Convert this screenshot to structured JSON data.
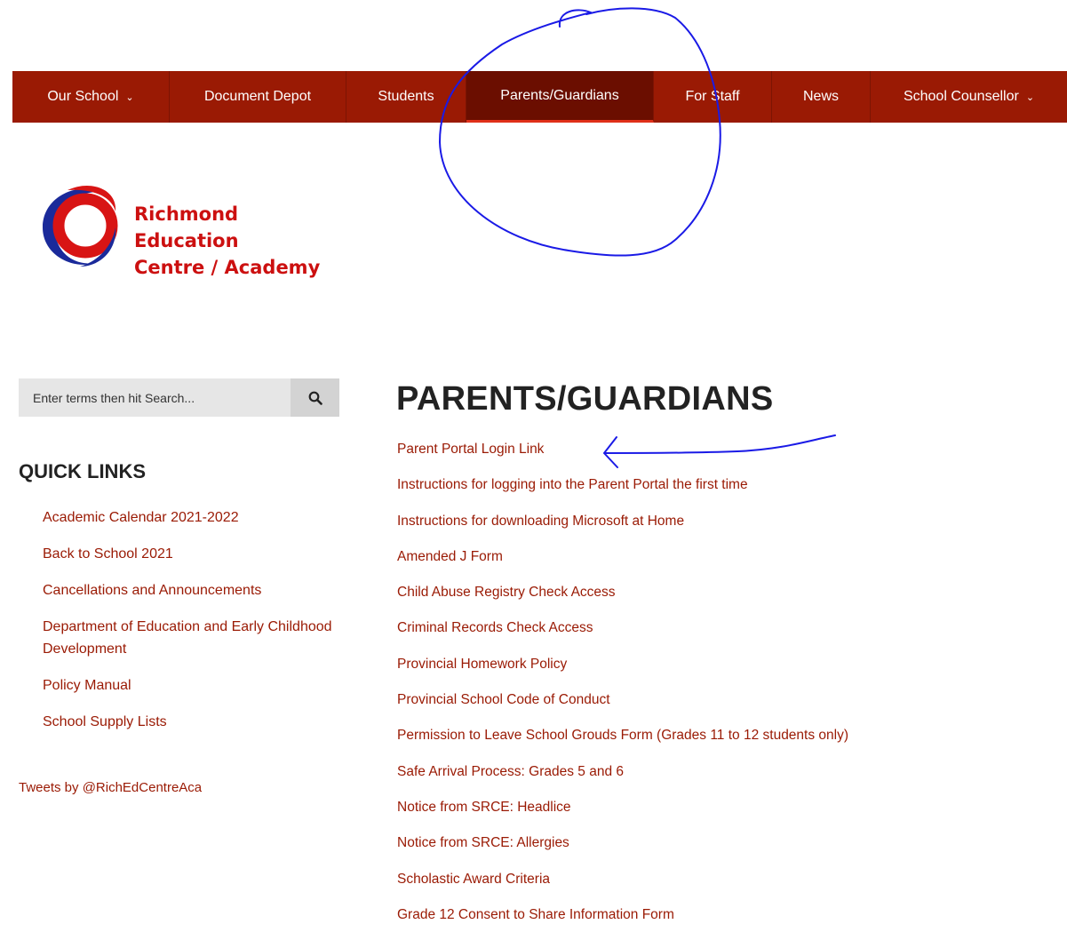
{
  "nav": {
    "items": [
      {
        "label": "Our School",
        "dropdown": true
      },
      {
        "label": "Document Depot",
        "dropdown": false
      },
      {
        "label": "Students",
        "dropdown": false
      },
      {
        "label": "Parents/Guardians",
        "dropdown": false,
        "active": true
      },
      {
        "label": "For Staff",
        "dropdown": false
      },
      {
        "label": "News",
        "dropdown": false
      },
      {
        "label": "School Counsellor",
        "dropdown": true
      }
    ],
    "chevron": "⌄"
  },
  "logo": {
    "line1": "Richmond Education",
    "line2": "Centre / Academy"
  },
  "search": {
    "placeholder": "Enter terms then hit Search..."
  },
  "sidebar": {
    "title": "QUICK LINKS",
    "links": [
      "Academic Calendar 2021-2022",
      "Back to School 2021",
      "Cancellations and Announcements",
      "Department of Education and Early Childhood Development",
      "Policy Manual",
      "School Supply Lists"
    ],
    "tweets": "Tweets by @RichEdCentreAca"
  },
  "main": {
    "title": "PARENTS/GUARDIANS",
    "links": [
      "Parent Portal Login Link",
      "Instructions for logging into the Parent Portal the first time",
      "Instructions for downloading Microsoft at Home",
      "Amended J Form",
      "Child Abuse Registry Check Access",
      "Criminal Records Check Access",
      "Provincial Homework Policy",
      "Provincial School Code of Conduct",
      "Permission to Leave School Grouds Form (Grades 11 to 12 students only)",
      "Safe Arrival Process: Grades 5 and 6",
      "Notice from SRCE:  Headlice",
      "Notice from SRCE:  Allergies",
      "Scholastic Award Criteria",
      "Grade 12 Consent to Share Information Form"
    ]
  },
  "colors": {
    "nav_bg": "#9a1a04",
    "nav_active": "#6b0e00",
    "link": "#9a1a04",
    "annotation": "#1a1ae6"
  },
  "icons": {
    "search": "search-icon",
    "chevron": "chevron-down-icon"
  }
}
